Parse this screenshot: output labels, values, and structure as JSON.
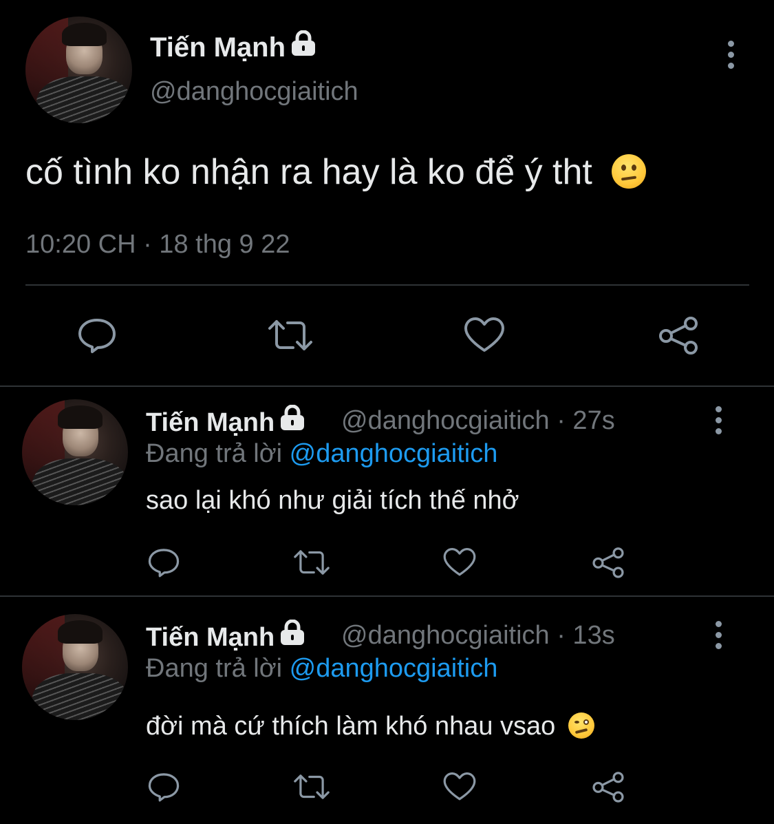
{
  "main_tweet": {
    "author_name": "Tiến Mạnh",
    "handle": "@danghocgiaitich",
    "text": "cố tình ko nhận ra hay là ko để ý tht",
    "emoji": "neutral-face",
    "timestamp": "10:20 CH · 18 thg 9 22"
  },
  "replies": [
    {
      "author_name": "Tiến Mạnh",
      "handle": "@danghocgiaitich · 27s",
      "replying_label": "Đang trả lời",
      "replying_to": "@danghocgiaitich",
      "text": "sao lại khó như giải tích thế nhở"
    },
    {
      "author_name": "Tiến Mạnh",
      "handle": "@danghocgiaitich · 13s",
      "replying_label": "Đang trả lời",
      "replying_to": "@danghocgiaitich",
      "text": "đời mà cứ thích làm khó nhau vsao",
      "emoji": "woozy-face"
    }
  ],
  "colors": {
    "background": "#000000",
    "text": "#e7e9ea",
    "secondary": "#71767b",
    "accent": "#1d9bf0",
    "divider": "#2f3336"
  },
  "icons": [
    "lock-icon",
    "more-icon",
    "reply-icon",
    "retweet-icon",
    "like-icon",
    "share-icon"
  ]
}
